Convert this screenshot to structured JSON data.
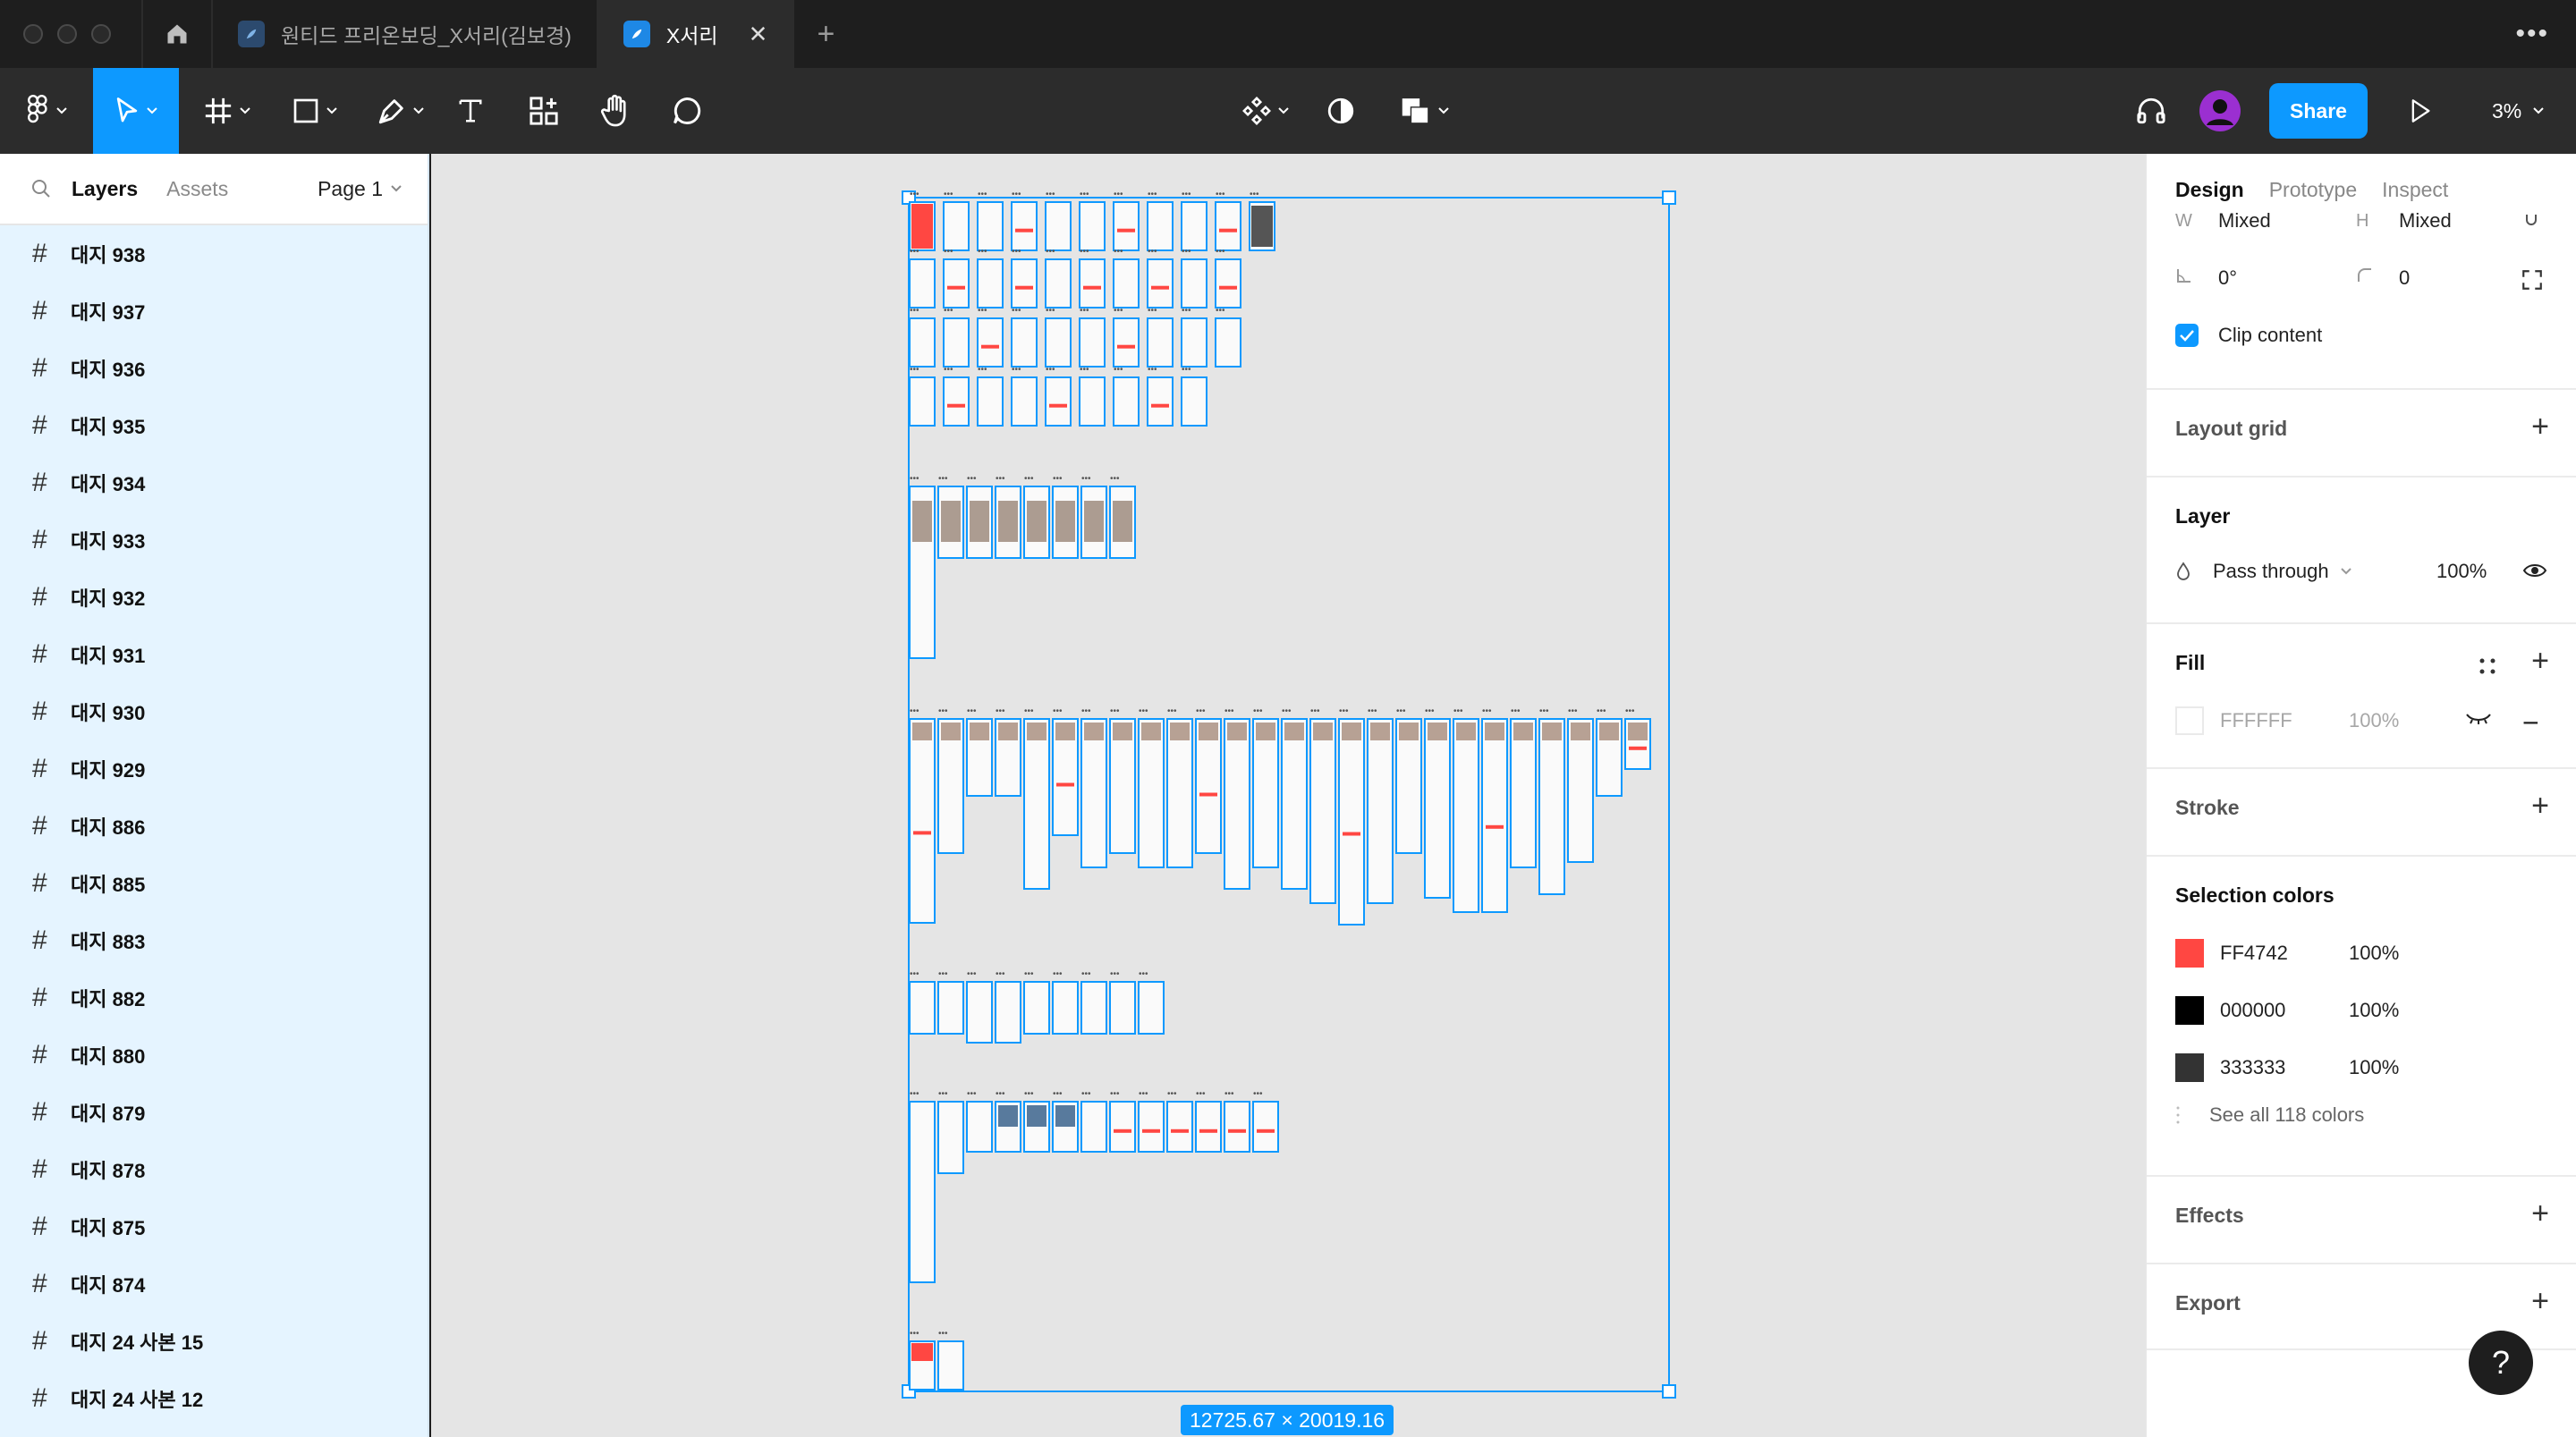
{
  "titlebar": {
    "tabs": [
      {
        "label": "원티드 프리온보딩_X서리(김보경)",
        "active": false
      },
      {
        "label": "X서리",
        "active": true
      }
    ]
  },
  "toolbar": {
    "share_label": "Share",
    "zoom": "3%"
  },
  "left_panel": {
    "tab_layers": "Layers",
    "tab_assets": "Assets",
    "page": "Page 1",
    "layers": [
      "대지 938",
      "대지 937",
      "대지 936",
      "대지 935",
      "대지 934",
      "대지 933",
      "대지 932",
      "대지 931",
      "대지 930",
      "대지 929",
      "대지 886",
      "대지 885",
      "대지 883",
      "대지 882",
      "대지 880",
      "대지 879",
      "대지 878",
      "대지 875",
      "대지 874",
      "대지 24 사본 15",
      "대지 24 사본 12"
    ]
  },
  "canvas": {
    "selection_size": "12725.67 × 20019.16"
  },
  "right_panel": {
    "tabs": {
      "design": "Design",
      "prototype": "Prototype",
      "inspect": "Inspect"
    },
    "w_label": "W",
    "w_value": "Mixed",
    "h_label": "H",
    "h_value": "Mixed",
    "rotation": "0°",
    "radius": "0",
    "clip_content": "Clip content",
    "layout_grid": "Layout grid",
    "layer_title": "Layer",
    "blend_mode": "Pass through",
    "layer_opacity": "100%",
    "fill_title": "Fill",
    "fill_hex": "FFFFFF",
    "fill_opacity": "100%",
    "stroke_title": "Stroke",
    "selection_colors_title": "Selection colors",
    "selection_colors": [
      {
        "hex": "FF4742",
        "opacity": "100%",
        "color": "#FF4742"
      },
      {
        "hex": "000000",
        "opacity": "100%",
        "color": "#000000"
      },
      {
        "hex": "333333",
        "opacity": "100%",
        "color": "#333333"
      }
    ],
    "see_all": "See all 118 colors",
    "effects_title": "Effects",
    "export_title": "Export"
  },
  "help_label": "?"
}
